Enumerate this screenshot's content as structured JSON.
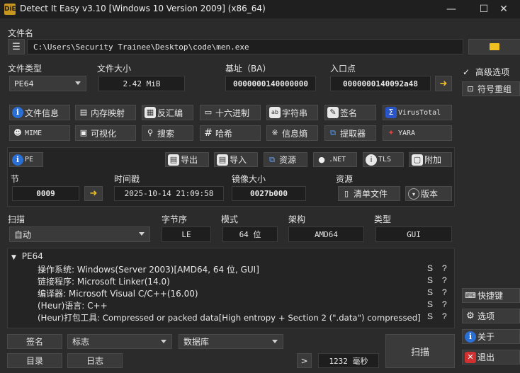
{
  "window": {
    "title": "Detect It Easy v3.10 [Windows 10 Version 2009] (x86_64)",
    "app_icon_text": "DiE",
    "minimize": "—",
    "maximize": "☐",
    "close": "✕"
  },
  "file": {
    "label": "文件名",
    "path": "C:\\Users\\Security Trainee\\Desktop\\code\\men.exe"
  },
  "info": {
    "type_label": "文件类型",
    "type_value": "PE64",
    "size_label": "文件大小",
    "size_value": "2.42 MiB",
    "base_label": "基址（BA）",
    "base_value": "0000000140000000",
    "entry_label": "入口点",
    "entry_value": "0000000140092a48"
  },
  "tools_row1": [
    {
      "label": "文件信息",
      "icon": "info-icon"
    },
    {
      "label": "内存映射",
      "icon": "memory-map-icon"
    },
    {
      "label": "反汇编",
      "icon": "disasm-icon"
    },
    {
      "label": "十六进制",
      "icon": "hex-icon"
    },
    {
      "label": "字符串",
      "icon": "strings-icon"
    },
    {
      "label": "签名",
      "icon": "signature-icon"
    },
    {
      "label": "VirusTotal",
      "icon": "virustotal-icon"
    }
  ],
  "tools_row2": [
    {
      "label": "MIME",
      "icon": "mime-icon"
    },
    {
      "label": "可视化",
      "icon": "visualize-icon"
    },
    {
      "label": "搜索",
      "icon": "search-icon"
    },
    {
      "label": "哈希",
      "icon": "hash-icon"
    },
    {
      "label": "信息熵",
      "icon": "entropy-icon"
    },
    {
      "label": "提取器",
      "icon": "extractor-icon"
    },
    {
      "label": "YARA",
      "icon": "yara-icon"
    }
  ],
  "pe_row": {
    "pe": "PE",
    "export": "导出",
    "import": "导入",
    "resources": "资源",
    "net": ".NET",
    "tls": "TLS",
    "overlay": "附加"
  },
  "pe_info": {
    "section_label": "节",
    "section_value": "0009",
    "timestamp_label": "时间戳",
    "timestamp_value": "2025-10-14 21:09:58",
    "image_size_label": "镜像大小",
    "image_size_value": "0027b000",
    "resources_label": "资源",
    "manifest_btn": "清单文件",
    "version_btn": "版本"
  },
  "scan": {
    "label": "扫描",
    "mode_value": "自动",
    "endian_label": "字节序",
    "endian_value": "LE",
    "mode_label": "模式",
    "bits_value": "64 位",
    "arch_label": "架构",
    "arch_value": "AMD64",
    "type_label": "类型",
    "type_value": "GUI"
  },
  "results": {
    "root": "PE64",
    "rows": [
      {
        "text": "操作系统: Windows(Server 2003)[AMD64, 64 位, GUI]",
        "s": "S",
        "q": "?"
      },
      {
        "text": "链接程序: Microsoft Linker(14.0)",
        "s": "S",
        "q": "?"
      },
      {
        "text": "编译器: Microsoft Visual C/C++(16.00)",
        "s": "S",
        "q": "?"
      },
      {
        "text": "(Heur)语言: C++",
        "s": "S",
        "q": "?"
      },
      {
        "text": "(Heur)打包工具: Compressed or packed data[High entropy + Section 2 (\".data\") compressed]",
        "s": "S",
        "q": "?"
      }
    ]
  },
  "bottom": {
    "signatures_btn": "签名",
    "flags_value": "标志",
    "database_value": "数据库",
    "directory_btn": "目录",
    "log_btn": "日志",
    "more_btn": ">",
    "time_value": "1232 毫秒",
    "scan_btn": "扫描"
  },
  "side": {
    "advanced_label": "高级选项",
    "advanced_checked": "✓",
    "symbol_btn": "符号重组",
    "shortcuts_btn": "快捷键",
    "options_btn": "选项",
    "about_btn": "关于",
    "exit_btn": "退出"
  }
}
